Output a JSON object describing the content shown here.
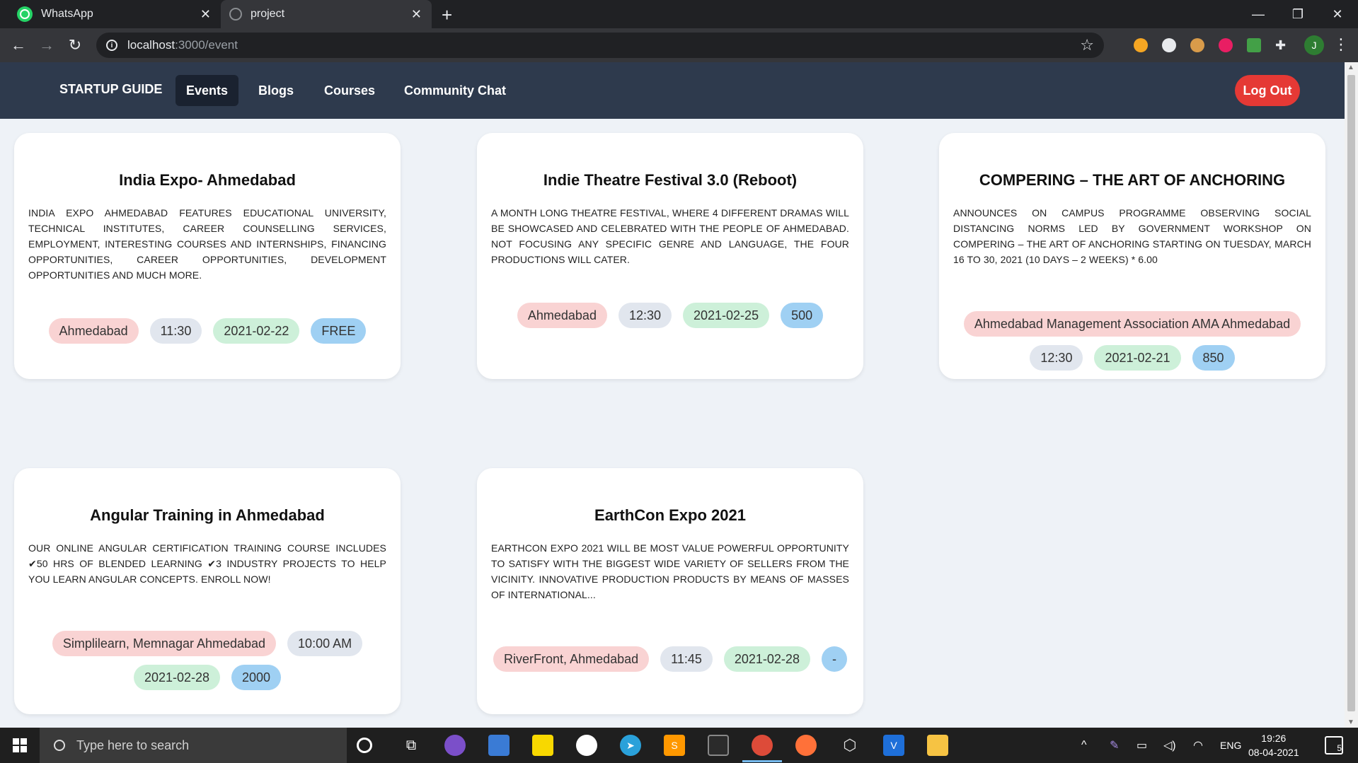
{
  "browser": {
    "tabs": [
      {
        "title": "WhatsApp",
        "active": false
      },
      {
        "title": "project",
        "active": true
      }
    ],
    "url_host": "localhost",
    "url_path": ":3000/event",
    "profile_initial": "J"
  },
  "navbar": {
    "brand": "STARTUP GUIDE",
    "links": [
      "Events",
      "Blogs",
      "Courses",
      "Community Chat"
    ],
    "active_link": "Events",
    "logout_label": "Log Out"
  },
  "events": [
    {
      "title": "India Expo- Ahmedabad",
      "description": "India Expo Ahmedabad features Educational University, Technical Institutes, Career Counselling Services, Employment, Interesting Courses and Internships, Financing Opportunities, Career Opportunities, Development Opportunities and much more.",
      "location": "Ahmedabad",
      "time": "11:30",
      "date": "2021-02-22",
      "price": "FREE"
    },
    {
      "title": "Indie Theatre Festival 3.0 (Reboot)",
      "description": "A month long theatre festival, where 4 different dramas will be showcased and celebrated with the people of Ahmedabad. Not focusing any specific genre and language, the four productions will cater.",
      "location": "Ahmedabad",
      "time": "12:30",
      "date": "2021-02-25",
      "price": "500"
    },
    {
      "title": "COMPERING – THE ART OF ANCHORING",
      "description": "Announces on campus programme observing social distancing norms led by government workshop on compering – the art of anchoring starting on Tuesday, March 16 to 30, 2021 (10 days – 2 weeks) * 6.00",
      "location": "Ahmedabad Management Association AMA Ahmedabad",
      "time": "12:30",
      "date": "2021-02-21",
      "price": "850"
    },
    {
      "title": "Angular Training in Ahmedabad",
      "description": "Our online Angular certification training course includes ✔50 hrs of blended learning ✔3 industry projects to help you learn Angular concepts. Enroll now!",
      "location": "Simplilearn, Memnagar Ahmedabad",
      "time": "10:00 AM",
      "date": "2021-02-28",
      "price": "2000"
    },
    {
      "title": "EarthCon Expo 2021",
      "description": "EarthCon Expo 2021 will be most value powerful opportunity to satisfy with the biggest wide variety of sellers from the vicinity. Innovative production products by means of masses of international...",
      "location": "RiverFront, Ahmedabad",
      "time": "11:45",
      "date": "2021-02-28",
      "price": "-"
    }
  ],
  "taskbar": {
    "search_placeholder": "Type here to search",
    "language": "ENG",
    "time": "19:26",
    "date": "08-04-2021",
    "notification_count": "5"
  },
  "colors": {
    "navbar_bg": "#2e3a4d",
    "logout_bg": "#e53935",
    "tag_location": "#f9d3d3",
    "tag_time": "#e1e6ee",
    "tag_date": "#cdf0d9",
    "tag_price": "#9fd0f3"
  }
}
